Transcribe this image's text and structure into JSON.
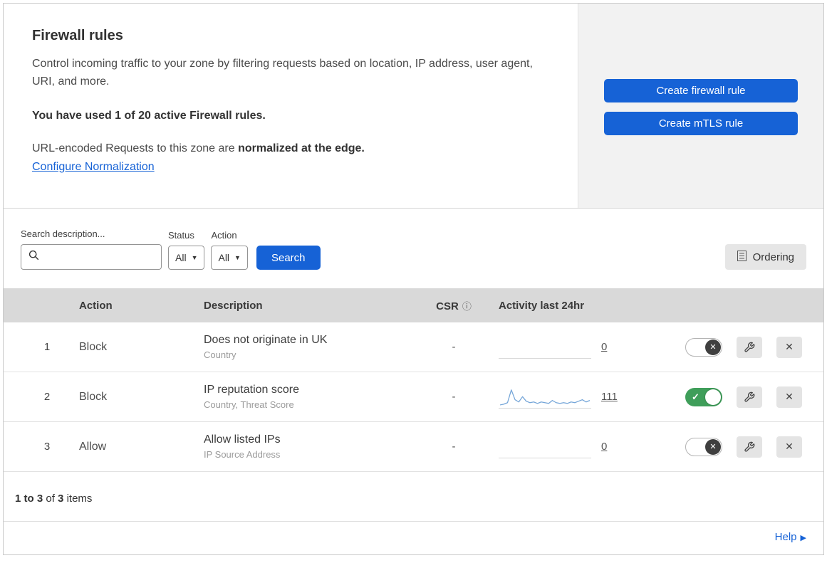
{
  "header": {
    "title": "Firewall rules",
    "description": "Control incoming traffic to your zone by filtering requests based on location, IP address, user agent, URI, and more.",
    "usage_note": "You have used 1 of 20 active Firewall rules.",
    "normalization_text": "URL-encoded Requests to this zone are",
    "normalization_bold": "normalized at the edge.",
    "normalization_link": "Configure Normalization"
  },
  "actions_panel": {
    "create_firewall_rule": "Create firewall rule",
    "create_mtls_rule": "Create mTLS rule"
  },
  "filters": {
    "search_label": "Search description...",
    "status_label": "Status",
    "status_value": "All",
    "action_label": "Action",
    "action_value": "All",
    "search_button": "Search",
    "ordering_button": "Ordering"
  },
  "table": {
    "headers": {
      "action": "Action",
      "description": "Description",
      "csr": "CSR",
      "activity": "Activity last 24hr"
    },
    "rows": [
      {
        "priority": "1",
        "action": "Block",
        "description": "Does not originate in UK",
        "fields": "Country",
        "csr": "-",
        "activity_count": "0",
        "enabled": false,
        "sparkline": []
      },
      {
        "priority": "2",
        "action": "Block",
        "description": "IP reputation score",
        "fields": "Country, Threat Score",
        "csr": "-",
        "activity_count": "111",
        "enabled": true,
        "sparkline": [
          2,
          3,
          5,
          22,
          9,
          6,
          13,
          7,
          5,
          6,
          4,
          6,
          5,
          4,
          8,
          5,
          4,
          5,
          4,
          6,
          5,
          7,
          9,
          6,
          8
        ]
      },
      {
        "priority": "3",
        "action": "Allow",
        "description": "Allow listed IPs",
        "fields": "IP Source Address",
        "csr": "-",
        "activity_count": "0",
        "enabled": false,
        "sparkline": []
      }
    ],
    "footer": {
      "range": "1 to 3",
      "of_label": "of",
      "total": "3",
      "items_label": "items"
    }
  },
  "help": {
    "label": "Help"
  },
  "colors": {
    "primary_blue": "#1662d6",
    "toggle_green": "#3f9e5a",
    "sparkline_blue": "#74a5d8",
    "table_header_gray": "#d9d9d9",
    "panel_gray": "#f2f2f2",
    "link_blue": "#1662d6"
  }
}
